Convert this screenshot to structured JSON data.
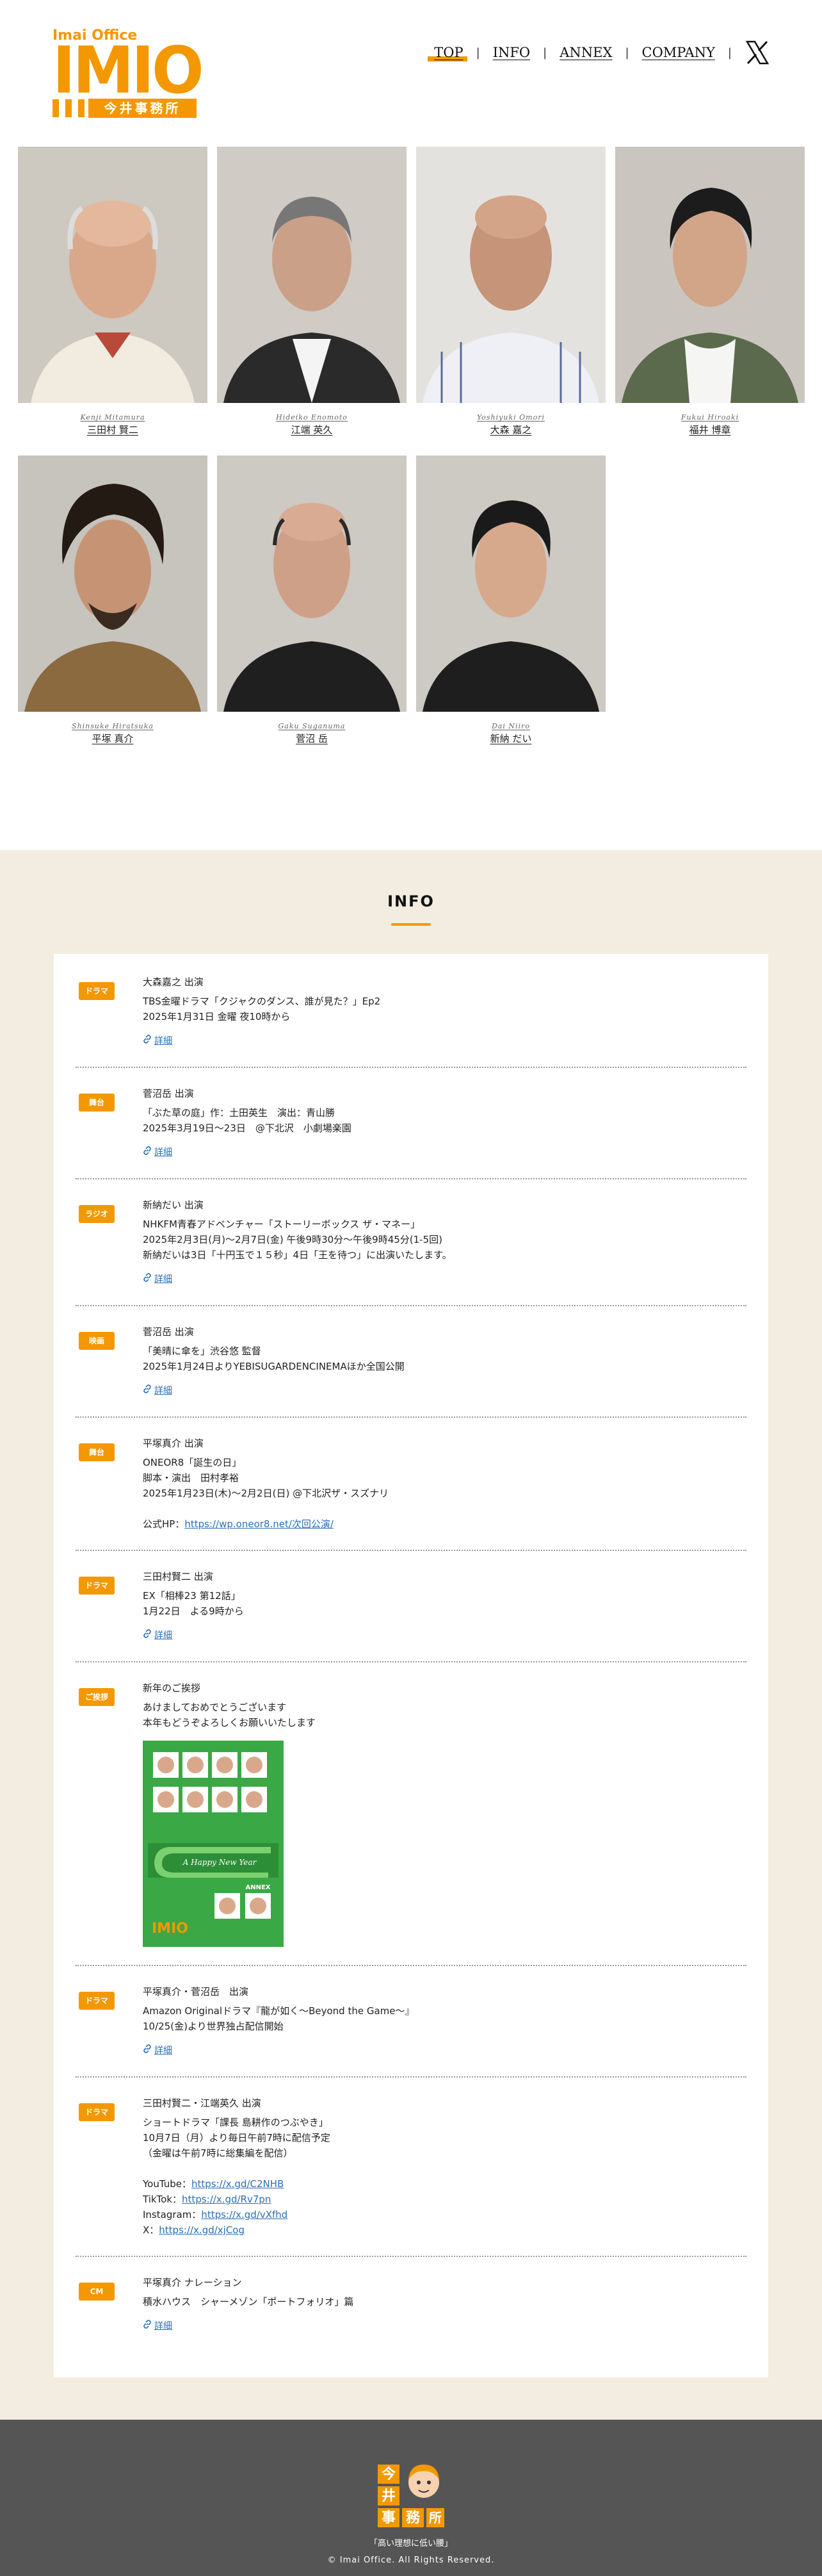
{
  "logo": {
    "small": "Imai Office",
    "big": "IMIO",
    "kanji": "今井事務所"
  },
  "nav": [
    {
      "label": "TOP",
      "active": true
    },
    {
      "label": "INFO",
      "active": false
    },
    {
      "label": "ANNEX",
      "active": false
    },
    {
      "label": "COMPANY",
      "active": false
    }
  ],
  "talents": [
    {
      "roman": "Kenji Mitamura",
      "name": "三田村 賢二"
    },
    {
      "roman": "Hideiko Enomoto",
      "name": "江端 英久"
    },
    {
      "roman": "Yoshiyuki Omori",
      "name": "大森 嘉之"
    },
    {
      "roman": "Fukui Hiroaki",
      "name": "福井 博章"
    },
    {
      "roman": "Shinsuke Hiratsuka",
      "name": "平塚 真介"
    },
    {
      "roman": "Gaku Suganuma",
      "name": "菅沼 岳"
    },
    {
      "roman": "Dai Niiro",
      "name": "新納 だい"
    }
  ],
  "info": {
    "title": "INFO",
    "detail_label": "詳細",
    "entries": [
      {
        "badge": "ドラマ",
        "lines": [
          "大森嘉之 出演",
          "TBS金曜ドラマ「クジャクのダンス、誰が見た？」Ep2",
          "2025年1月31日 金曜 夜10時から"
        ],
        "detail": true
      },
      {
        "badge": "舞台",
        "lines": [
          "菅沼岳 出演",
          "「ぶた草の庭」作：土田英生　演出：青山勝",
          "2025年3月19日〜23日　@下北沢　小劇場楽園"
        ],
        "detail": true
      },
      {
        "badge": "ラジオ",
        "lines": [
          "新納だい 出演",
          "NHKFM青春アドベンチャー「ストーリーボックス ザ・マネー」",
          "2025年2月3日(月)〜2月7日(金) 午後9時30分〜午後9時45分(1-5回)",
          "新納だいは3日「十円玉で１５秒」4日「王を待つ」に出演いたします。"
        ],
        "detail": true
      },
      {
        "badge": "映画",
        "lines": [
          "菅沼岳 出演",
          "「美晴に傘を」渋谷悠 監督",
          "2025年1月24日よりYEBISUGARDENCINEMAほか全国公開"
        ],
        "detail": true
      },
      {
        "badge": "舞台",
        "lines": [
          "平塚真介 出演",
          "ONEOR8「誕生の日」",
          "脚本・演出　田村孝裕",
          "2025年1月23日(木)〜2月2日(日) @下北沢ザ・スズナリ",
          ""
        ],
        "hp_label": "公式HP：",
        "hp_link": "https://wp.oneor8.net/次回公演/",
        "detail": false
      },
      {
        "badge": "ドラマ",
        "lines": [
          "三田村賢二 出演",
          "EX「相棒23 第12話」",
          "1月22日　よる9時から"
        ],
        "detail": true
      },
      {
        "badge": "ご挨拶",
        "lines": [
          "新年のご挨拶",
          "あけましておめでとうございます",
          "本年もどうぞよろしくお願いいたします"
        ],
        "image": true,
        "image_text": "A Happy New Year",
        "image_logo": "IMIO",
        "image_annex": "ANNEX",
        "detail": false
      },
      {
        "badge": "ドラマ",
        "lines": [
          "平塚真介・菅沼岳　出演",
          "Amazon Originalドラマ『龍が如く〜Beyond the Game〜』",
          "10/25(金)より世界独占配信開始"
        ],
        "detail": true
      },
      {
        "badge": "ドラマ",
        "lines": [
          "三田村賢二・江端英久 出演",
          "ショートドラマ「課長 島耕作のつぶやき」",
          "10月7日（月）より毎日午前7時に配信予定",
          "（金曜は午前7時に総集編を配信）",
          ""
        ],
        "links": [
          {
            "label": "YouTube：",
            "url": "https://x.gd/C2NHB"
          },
          {
            "label": "TikTok：",
            "url": "https://x.gd/Rv7pn"
          },
          {
            "label": "Instagram：",
            "url": "https://x.gd/vXfhd"
          },
          {
            "label": "X：",
            "url": "https://x.gd/xjCog"
          }
        ],
        "detail": false
      },
      {
        "badge": "CM",
        "lines": [
          "平塚真介 ナレーション",
          "積水ハウス　シャーメゾン「ポートフォリオ」篇"
        ],
        "detail": true
      }
    ]
  },
  "footer": {
    "logo_chars": [
      "今",
      "井",
      "事",
      "務",
      "所"
    ],
    "tagline": "「高い理想に低い腰」",
    "copyright": "© Imai Office. All Rights Reserved."
  },
  "colors": {
    "accent": "#f39800",
    "info_bg": "#f2ede0",
    "footer_bg": "#555555",
    "link": "#2a6fb5"
  }
}
